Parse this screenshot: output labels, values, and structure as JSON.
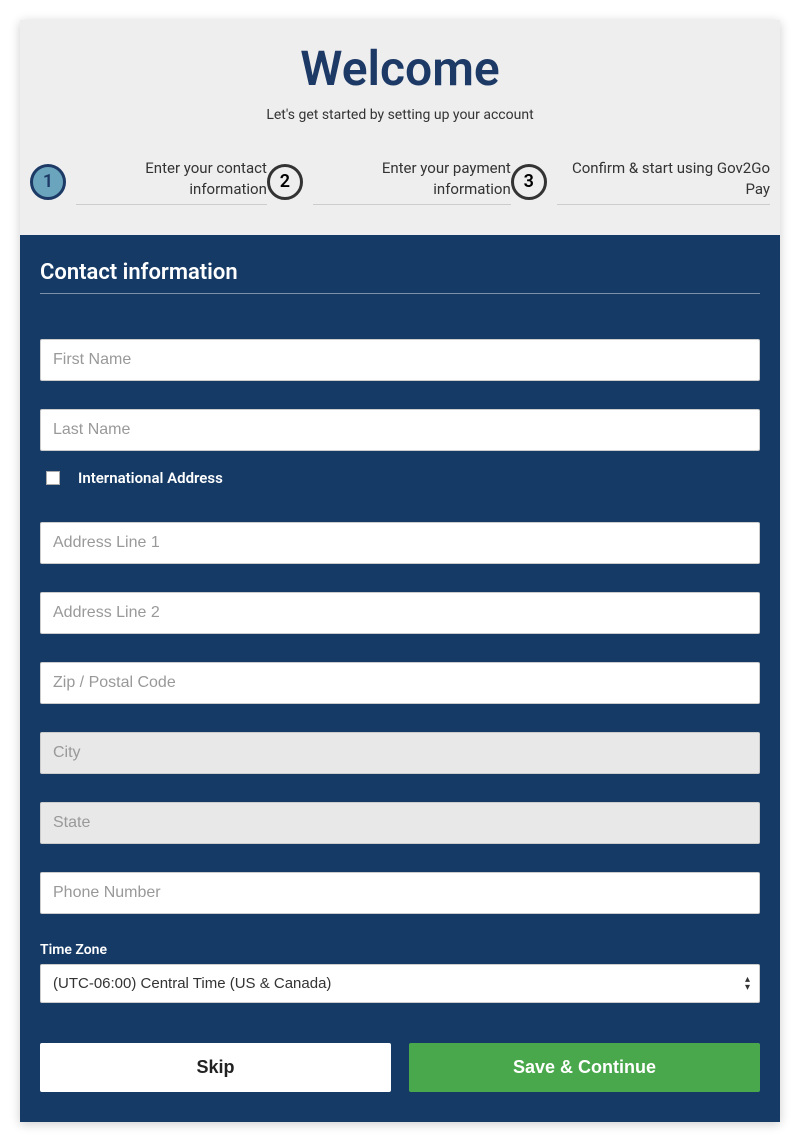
{
  "header": {
    "title": "Welcome",
    "subtitle": "Let's get started by setting up your account"
  },
  "steps": [
    {
      "number": "1",
      "label": "Enter your contact information",
      "active": true
    },
    {
      "number": "2",
      "label": "Enter your payment information",
      "active": false
    },
    {
      "number": "3",
      "label": "Confirm & start using Gov2Go Pay",
      "active": false
    }
  ],
  "form": {
    "section_title": "Contact information",
    "first_name_placeholder": "First Name",
    "last_name_placeholder": "Last Name",
    "international_label": "International Address",
    "address1_placeholder": "Address Line 1",
    "address2_placeholder": "Address Line 2",
    "zip_placeholder": "Zip / Postal Code",
    "city_placeholder": "City",
    "state_placeholder": "State",
    "phone_placeholder": "Phone Number",
    "timezone_label": "Time Zone",
    "timezone_value": "(UTC-06:00) Central Time (US & Canada)"
  },
  "buttons": {
    "skip": "Skip",
    "save": "Save & Continue"
  }
}
